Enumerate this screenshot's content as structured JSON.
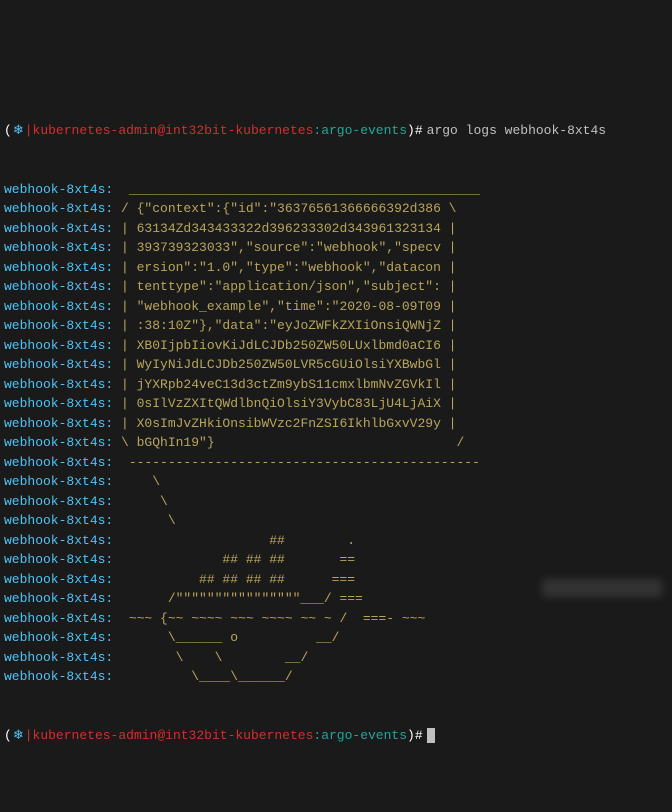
{
  "prompt": {
    "open_paren": "(",
    "icon": "❄",
    "separator": "|",
    "user": "kubernetes-admin@int32bit-kubernetes",
    "colon": ":",
    "context": "argo-events",
    "close_paren": ")",
    "symbol": "#"
  },
  "command": "argo logs webhook-8xt4s",
  "pod_name": "webhook-8xt4s",
  "log_lines": [
    "  _____________________________________________",
    " / {\"context\":{\"id\":\"36376561366666392d386 \\",
    " | 63134Zd343433322d396233302d343961323134 |",
    " | 393739323033\",\"source\":\"webhook\",\"specv |",
    " | ersion\":\"1.0\",\"type\":\"webhook\",\"datacon |",
    " | tenttype\":\"application/json\",\"subject\": |",
    " | \"webhook_example\",\"time\":\"2020-08-09T09 |",
    " | :38:10Z\"},\"data\":\"eyJoZWFkZXIiOnsiQWNjZ |",
    " | XB0IjpbIiovKiJdLCJDb250ZW50LUxlbmd0aCI6 |",
    " | WyIyNiJdLCJDb250ZW50LVR5cGUiOlsiYXBwbGl |",
    " | jYXRpb24veC13d3ctZm9ybS11cmxlbmNvZGVkIl |",
    " | 0sIlVzZXItQWdlbnQiOlsiY3VybC83LjU4LjAiX |",
    " | X0sImJvZHkiOnsibWVzc2FnZSI6IkhlbGxvV29y |",
    " \\ bGQhIn19\"}                               /",
    "  ---------------------------------------------",
    "     \\",
    "      \\",
    "       \\",
    "                    ##        .",
    "              ## ## ##       ==",
    "           ## ## ## ##      ===",
    "       /\"\"\"\"\"\"\"\"\"\"\"\"\"\"\"\"___/ ===",
    "  ~~~ {~~ ~~~~ ~~~ ~~~~ ~~ ~ /  ===- ~~~",
    "       \\______ o          __/",
    "        \\    \\        __/",
    "          \\____\\______/"
  ]
}
